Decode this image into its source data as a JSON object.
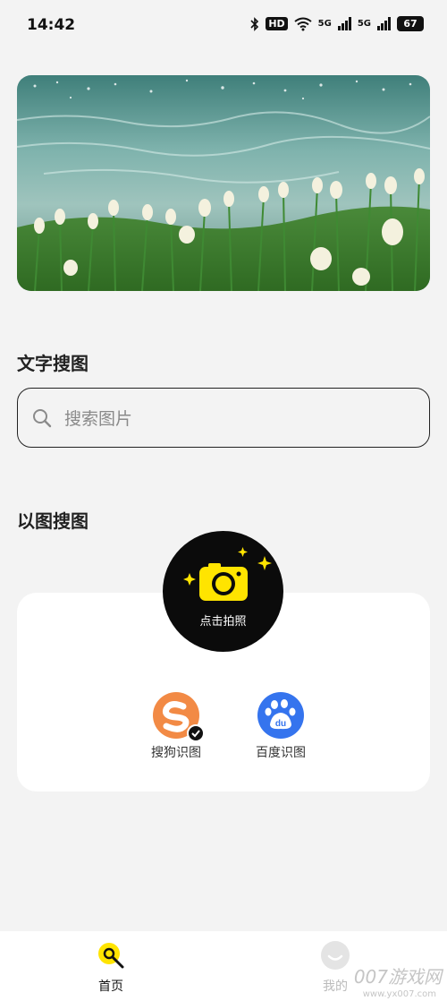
{
  "status": {
    "time": "14:42",
    "hd": "HD",
    "net1": "5G",
    "net2": "5G",
    "battery": "67"
  },
  "text_search": {
    "title": "文字搜图",
    "placeholder": "搜索图片"
  },
  "image_search": {
    "title": "以图搜图",
    "camera_label": "点击拍照",
    "engines": [
      {
        "label": "搜狗识图",
        "selected": true,
        "color": "#f28a45"
      },
      {
        "label": "百度识图",
        "selected": false,
        "color": "#3574ee"
      }
    ]
  },
  "tabs": [
    {
      "label": "首页",
      "active": true
    },
    {
      "label": "我的",
      "active": false
    }
  ],
  "watermark": {
    "text": "007游戏网",
    "url": "www.yx007.com"
  },
  "colors": {
    "accent": "#ffe400",
    "background": "#f3f3f3"
  }
}
